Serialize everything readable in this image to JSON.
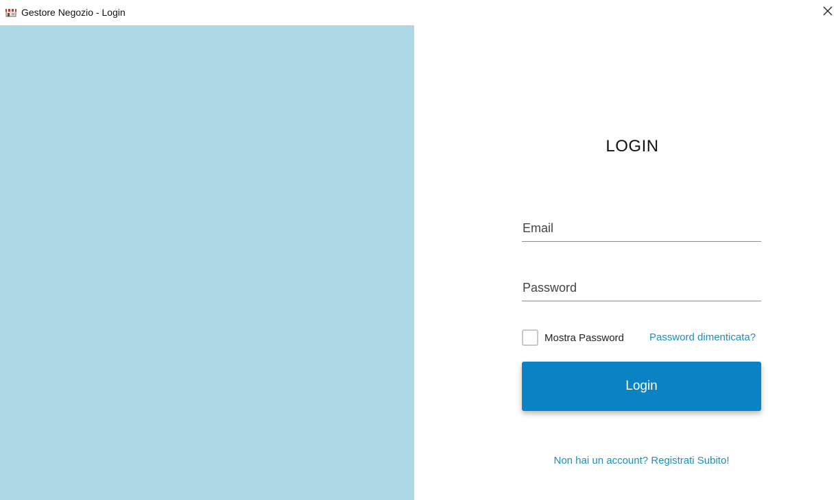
{
  "window": {
    "title": "Gestore Negozio - Login",
    "app_icon": "shop-icon",
    "close_icon": "close-icon"
  },
  "left_panel": {
    "background_color": "#add8e6"
  },
  "form": {
    "heading": "LOGIN",
    "email": {
      "placeholder": "Email",
      "value": ""
    },
    "password": {
      "placeholder": "Password",
      "value": ""
    },
    "show_password": {
      "label": "Mostra Password",
      "checked": false
    },
    "forgot_password": "Password dimenticata?",
    "login_button": "Login",
    "register_link": "Non hai un account? Registrati Subito!"
  },
  "colors": {
    "accent": "#0b82c4",
    "link": "#1a8fbf"
  }
}
